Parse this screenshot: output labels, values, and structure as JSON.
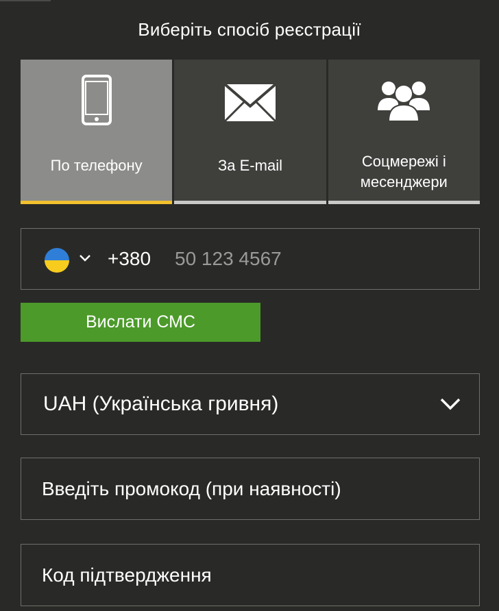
{
  "header": {
    "title": "Виберіть спосіб реєстрації"
  },
  "methods": [
    {
      "label": "По телефону",
      "icon": "smartphone-icon",
      "active": true
    },
    {
      "label": "За E-mail",
      "icon": "envelope-icon",
      "active": false
    },
    {
      "label_line1": "Соцмережі і",
      "label_line2": "месенджери",
      "icon": "users-group-icon",
      "active": false
    }
  ],
  "phone": {
    "flag_icon": "ukraine-flag-icon",
    "country_code": "+380",
    "placeholder": "50 123 4567"
  },
  "sms_button": {
    "label": "Вислати СМС"
  },
  "currency": {
    "selected": "UAH (Українська гривня)"
  },
  "promo": {
    "placeholder": "Введіть промокод (при наявності)"
  },
  "confirmation": {
    "placeholder": "Код підтвердження"
  },
  "colors": {
    "background": "#292a27",
    "active_tab": "#8c8d8a",
    "inactive_tab": "#3f403c",
    "active_underline": "#f2c12e",
    "inactive_underline": "#c9c9c7",
    "sms_button": "#4c9a2a",
    "field_border": "#6f706c",
    "placeholder_gray": "#9a9b98"
  }
}
